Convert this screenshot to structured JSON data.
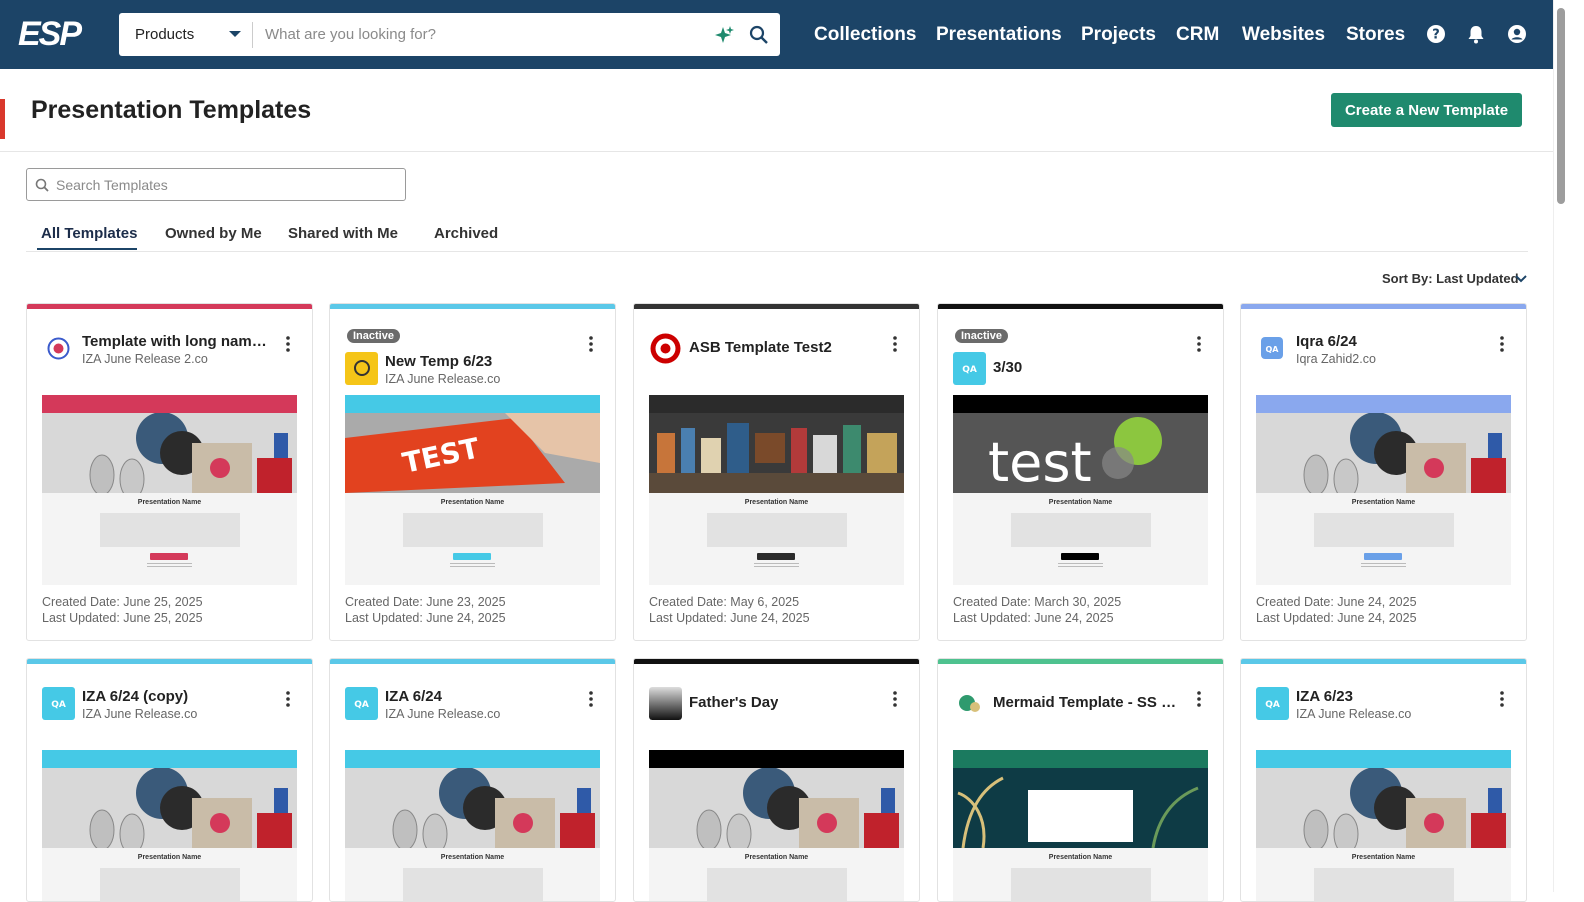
{
  "nav": {
    "logo": "ESP",
    "search_category": "Products",
    "search_placeholder": "What are you looking for?",
    "links": [
      "Collections",
      "Presentations",
      "Projects",
      "CRM",
      "Websites",
      "Stores"
    ],
    "icons": [
      "help-icon",
      "bell-icon",
      "account-icon"
    ]
  },
  "header": {
    "title": "Presentation Templates",
    "create_label": "Create a New Template"
  },
  "filter": {
    "search_placeholder": "Search Templates"
  },
  "tabs": [
    "All Templates",
    "Owned by Me",
    "Shared with Me",
    "Archived"
  ],
  "sort_label": "Sort By: Last Updated",
  "thumb_caption": "Presentation Name",
  "cards": [
    {
      "title": "Template with long name ...",
      "subtitle": "IZA June Release 2.co",
      "badge": "",
      "created": "Created Date: June 25, 2025",
      "updated": "Last Updated: June 25, 2025",
      "accent": "#d4395a",
      "thumb_bar": "#d4395a"
    },
    {
      "title": "New Temp 6/23",
      "subtitle": "IZA June Release.co",
      "badge": "Inactive",
      "created": "Created Date: June 23, 2025",
      "updated": "Last Updated: June 24, 2025",
      "accent": "#5bc8e8",
      "thumb_bar": "#45c9e6"
    },
    {
      "title": "ASB Template Test2",
      "subtitle": "",
      "badge": "",
      "created": "Created Date: May 6, 2025",
      "updated": "Last Updated: June 24, 2025",
      "accent": "#333333",
      "thumb_bar": "#2b2b2b"
    },
    {
      "title": "3/30",
      "subtitle": "",
      "badge": "Inactive",
      "created": "Created Date: March 30, 2025",
      "updated": "Last Updated: June 24, 2025",
      "accent": "#111111",
      "thumb_bar": "#000000"
    },
    {
      "title": "Iqra 6/24",
      "subtitle": "Iqra Zahid2.co",
      "badge": "",
      "created": "Created Date: June 24, 2025",
      "updated": "Last Updated: June 24, 2025",
      "accent": "#8aa8ee",
      "thumb_bar": "#8aa8ee"
    },
    {
      "title": "IZA 6/24 (copy)",
      "subtitle": "IZA June Release.co",
      "badge": "",
      "created": "",
      "updated": "",
      "accent": "#5bc8e8",
      "thumb_bar": "#45c9e6"
    },
    {
      "title": "IZA 6/24",
      "subtitle": "IZA June Release.co",
      "badge": "",
      "created": "",
      "updated": "",
      "accent": "#5bc8e8",
      "thumb_bar": "#45c9e6"
    },
    {
      "title": "Father's Day",
      "subtitle": "",
      "badge": "",
      "created": "",
      "updated": "",
      "accent": "#111111",
      "thumb_bar": "#000000"
    },
    {
      "title": "Mermaid Template - SS D...",
      "subtitle": "",
      "badge": "",
      "created": "",
      "updated": "",
      "accent": "#4ec28f",
      "thumb_bar": "#1b7a5f"
    },
    {
      "title": "IZA 6/23",
      "subtitle": "IZA June Release.co",
      "badge": "",
      "created": "",
      "updated": "",
      "accent": "#5bc8e8",
      "thumb_bar": "#45c9e6"
    }
  ]
}
